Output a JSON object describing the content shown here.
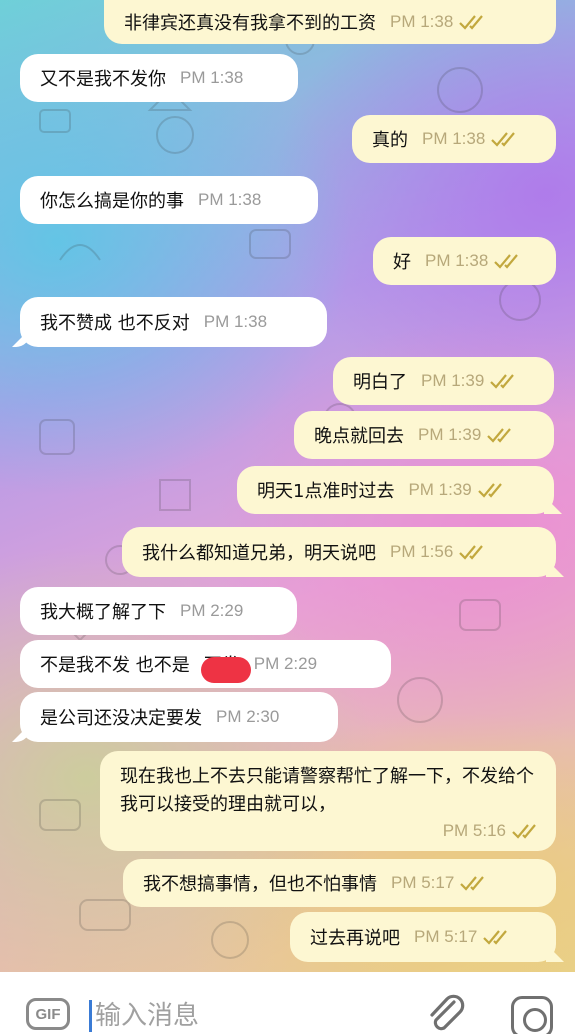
{
  "messages": [
    {
      "dir": "out",
      "text": "非律宾还真没有我拿不到的工资",
      "time": "PM 1:38"
    },
    {
      "dir": "in",
      "text": "又不是我不发你",
      "time": "PM 1:38"
    },
    {
      "dir": "out",
      "text": "真的",
      "time": "PM 1:38"
    },
    {
      "dir": "in",
      "text": "你怎么搞是你的事",
      "time": "PM 1:38"
    },
    {
      "dir": "out",
      "text": "好",
      "time": "PM 1:38"
    },
    {
      "dir": "in",
      "text": "我不赞成  也不反对",
      "time": "PM 1:38"
    },
    {
      "dir": "out",
      "text": "明白了",
      "time": "PM 1:39"
    },
    {
      "dir": "out",
      "text": "晚点就回去",
      "time": "PM 1:39"
    },
    {
      "dir": "out",
      "text": "明天1点准时过去",
      "time": "PM 1:39"
    },
    {
      "dir": "out",
      "text": "我什么都知道兄弟，明天说吧",
      "time": "PM 1:56"
    },
    {
      "dir": "in",
      "text": "我大概了解了下",
      "time": "PM 2:29"
    },
    {
      "dir": "in",
      "text": "不是我不发  也不是",
      "text2": "不发",
      "time": "PM 2:29"
    },
    {
      "dir": "in",
      "text": "是公司还没决定要发",
      "time": "PM 2:30"
    },
    {
      "dir": "out",
      "text": "现在我也上不去只能请警察帮忙了解一下，不发给个我可以接受的理由就可以，",
      "time": "PM 5:16"
    },
    {
      "dir": "out",
      "text": "我不想搞事情，但也不怕事情",
      "time": "PM 5:17"
    },
    {
      "dir": "out",
      "text": "过去再说吧",
      "time": "PM 5:17"
    }
  ],
  "input": {
    "placeholder": "输入消息",
    "gif_label": "GIF",
    "attach_icon": "paperclip-icon",
    "camera_icon": "camera-icon"
  },
  "colors": {
    "incoming_bubble": "#ffffff",
    "outgoing_bubble": "#fdf7d2",
    "read_ticks": "#c2a83e"
  }
}
